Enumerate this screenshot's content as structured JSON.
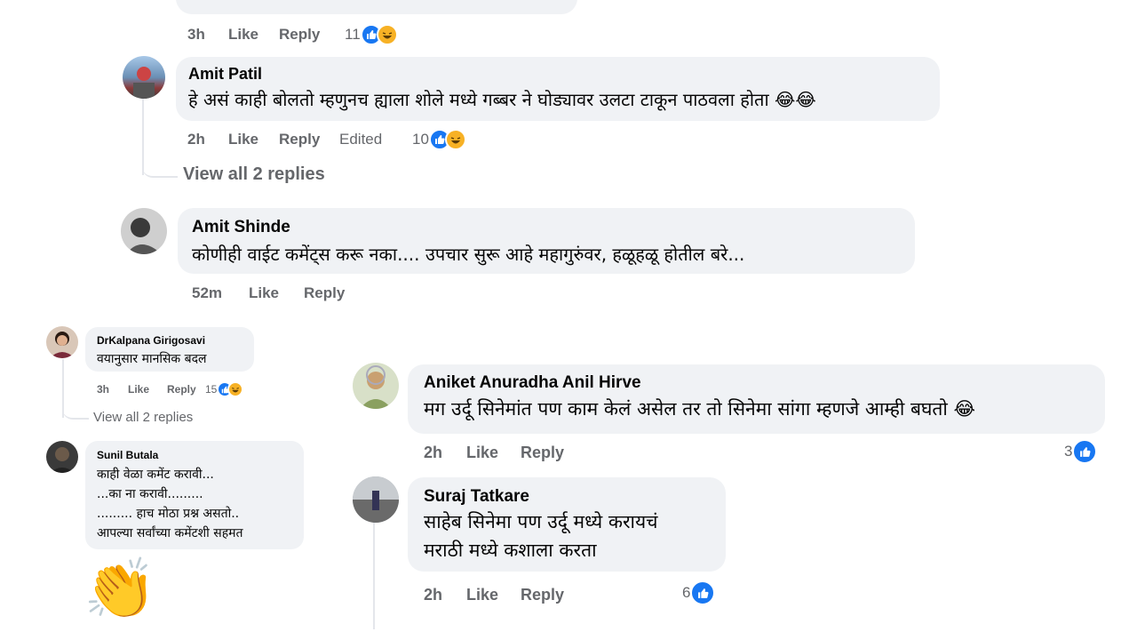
{
  "top_comment": {
    "time": "3h",
    "like": "Like",
    "reply": "Reply",
    "count": "11"
  },
  "amit_patil": {
    "name": "Amit Patil",
    "text": "हे असं काही बोलतो म्हणुनच ह्याला शोले मध्ये गब्बर ने घोड्यावर उलटा टाकून पाठवला होता 😂😂",
    "time": "2h",
    "like": "Like",
    "reply": "Reply",
    "edited": "Edited",
    "count": "10",
    "view_replies": "View all 2 replies"
  },
  "amit_shinde": {
    "name": "Amit Shinde",
    "text": "कोणीही वाईट कमेंट्स करू नका.... उपचार सुरू आहे महागुरुंवर, हळूहळू होतील बरे...",
    "time": "52m",
    "like": "Like",
    "reply": "Reply"
  },
  "kalpana": {
    "name": "DrKalpana Girigosavi",
    "text": "वयानुसार मानसिक बदल",
    "time": "3h",
    "like": "Like",
    "reply": "Reply",
    "count": "15",
    "view_replies": "View all 2 replies"
  },
  "sunil": {
    "name": "Sunil Butala",
    "lines": [
      "काही वेळा कमेंट करावी...",
      "...का ना करावी.........",
      "......... हाच मोठा प्रश्न असतो..",
      "आपल्या सर्वांच्या कमेंटशी सहमत"
    ],
    "sticker": "👏"
  },
  "aniket": {
    "name": "Aniket Anuradha Anil Hirve",
    "text": "मग उर्दू सिनेमांत पण काम केलं असेल तर तो सिनेमा सांगा म्हणजे आम्ही बघतो 😂",
    "time": "2h",
    "like": "Like",
    "reply": "Reply",
    "count": "3"
  },
  "suraj": {
    "name": "Suraj Tatkare",
    "line1": "साहेब सिनेमा पण उर्दू मध्ये करायचं",
    "line2": "मराठी मध्ये कशाला करता",
    "time": "2h",
    "like": "Like",
    "reply": "Reply",
    "count": "6"
  },
  "colors": {
    "like_blue": "#1877f2",
    "bubble": "#f0f2f5",
    "meta_gray": "#65676b",
    "haha_yellow": "#f7b125"
  }
}
